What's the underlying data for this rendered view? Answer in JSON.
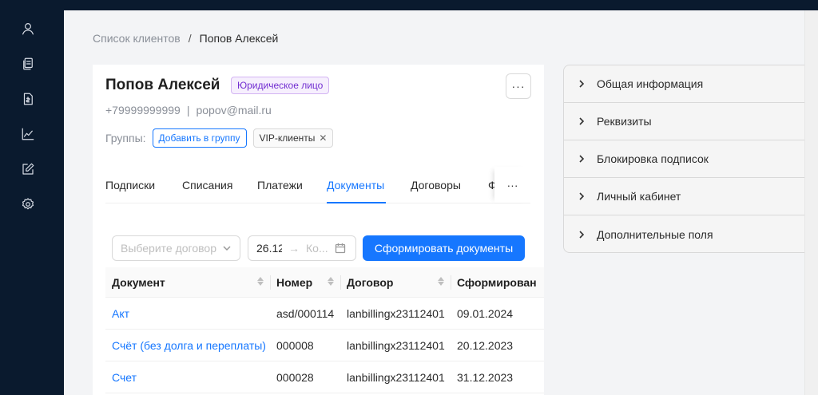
{
  "breadcrumb": {
    "parent": "Список клиентов",
    "separator": "/",
    "current": "Попов Алексей"
  },
  "client": {
    "name": "Попов Алексей",
    "type_badge": "Юридическое лицо",
    "phone": "+79999999999",
    "contact_separator": "|",
    "email": "popov@mail.ru",
    "more_label": "···"
  },
  "groups": {
    "label": "Группы:",
    "add_button": "Добавить в группу",
    "tags": [
      "VIP-клиенты"
    ]
  },
  "tabs": {
    "items": [
      "Подписки",
      "Списания",
      "Платежи",
      "Документы",
      "Договоры",
      "Ф"
    ],
    "active": "Документы",
    "more_label": "···"
  },
  "filters": {
    "contract_placeholder": "Выберите договор",
    "date_start": "26.12",
    "date_arrow": "→",
    "date_end_placeholder": "Ко...",
    "generate_button": "Сформировать документы"
  },
  "table": {
    "columns": [
      "Документ",
      "Номер",
      "Договор",
      "Сформирован"
    ],
    "rows": [
      [
        "Акт",
        "asd/000114",
        "lanbillingx23112401",
        "09.01.2024"
      ],
      [
        "Счёт (без долга и переплаты)",
        "000008",
        "lanbillingx23112401",
        "20.12.2023"
      ],
      [
        "Счет",
        "000028",
        "lanbillingx23112401",
        "31.12.2023"
      ]
    ]
  },
  "right_panel": {
    "items": [
      "Общая информация",
      "Реквизиты",
      "Блокировка подписок",
      "Личный кабинет",
      "Дополнительные поля"
    ]
  },
  "sidebar": {
    "icons": [
      "user-icon",
      "copy-document-icon",
      "invoice-icon",
      "chart-line-icon",
      "edit-square-icon",
      "gear-icon"
    ]
  },
  "colors": {
    "sidebar_bg": "#0a1a2e",
    "accent": "#1677ff",
    "badge_purple": "#722ed1"
  }
}
